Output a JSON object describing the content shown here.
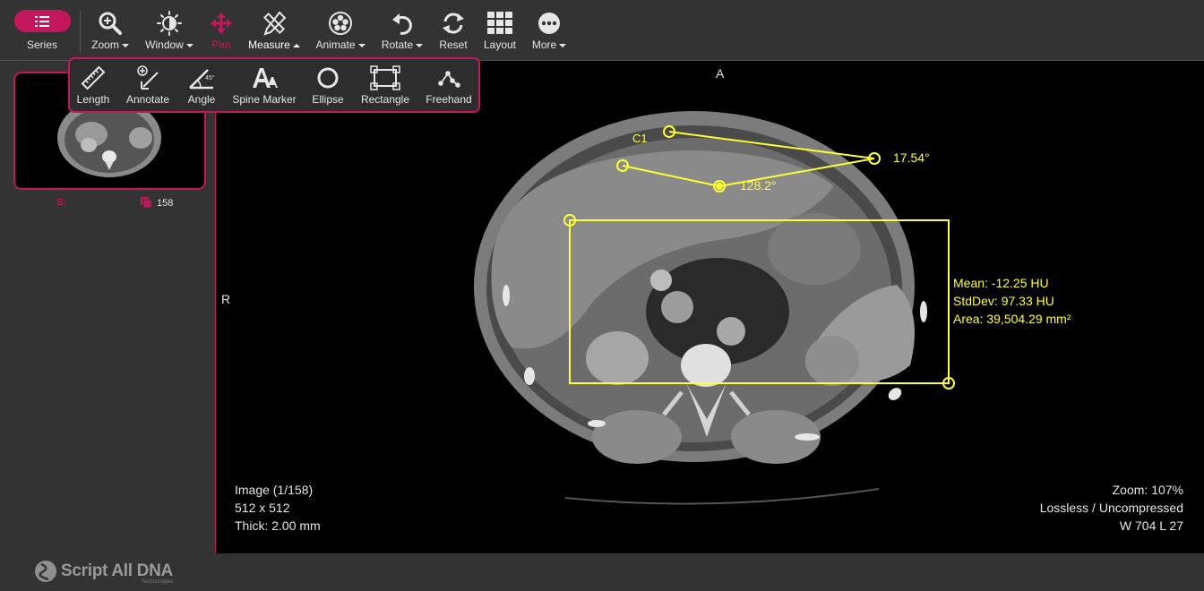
{
  "toolbar": {
    "series_label": "Series",
    "tools": [
      {
        "label": "Zoom",
        "icon": "zoom-icon"
      },
      {
        "label": "Window",
        "icon": "window-level-icon"
      },
      {
        "label": "Pan",
        "icon": "pan-icon"
      },
      {
        "label": "Measure",
        "icon": "measure-icon"
      },
      {
        "label": "Animate",
        "icon": "animate-icon"
      },
      {
        "label": "Rotate",
        "icon": "rotate-icon"
      },
      {
        "label": "Reset",
        "icon": "reset-icon"
      },
      {
        "label": "Layout",
        "icon": "layout-icon"
      },
      {
        "label": "More",
        "icon": "more-icon"
      }
    ]
  },
  "measure_menu": {
    "items": [
      {
        "label": "Length",
        "icon": "ruler-icon"
      },
      {
        "label": "Annotate",
        "icon": "annotate-icon"
      },
      {
        "label": "Angle",
        "icon": "angle-icon"
      },
      {
        "label": "Spine Marker",
        "icon": "spine-marker-icon"
      },
      {
        "label": "Ellipse",
        "icon": "ellipse-icon"
      },
      {
        "label": "Rectangle",
        "icon": "rectangle-icon"
      },
      {
        "label": "Freehand",
        "icon": "freehand-icon"
      }
    ]
  },
  "sidebar": {
    "series_tag": "S:",
    "image_count": "158"
  },
  "viewport": {
    "orientation_top": "A",
    "orientation_left": "R",
    "annotation_label": "C1",
    "angle_1": "17.54°",
    "angle_2": "128.2°",
    "roi_stats": {
      "mean": "Mean: -12.25 HU",
      "stddev": "StdDev: 97.33 HU",
      "area": "Area: 39,504.29 mm²"
    },
    "info_left": {
      "image": "Image (1/158)",
      "matrix": "512 x 512",
      "thickness": "Thick: 2.00 mm"
    },
    "info_right": {
      "zoom": "Zoom: 107%",
      "compression": "Lossless / Uncompressed",
      "window": "W 704 L 27"
    }
  },
  "footer": {
    "logo_text": "Script All DNA",
    "logo_sub": "Technologies"
  },
  "colors": {
    "accent": "#c2185b",
    "measurement": "#ffff33",
    "background": "#333333"
  }
}
